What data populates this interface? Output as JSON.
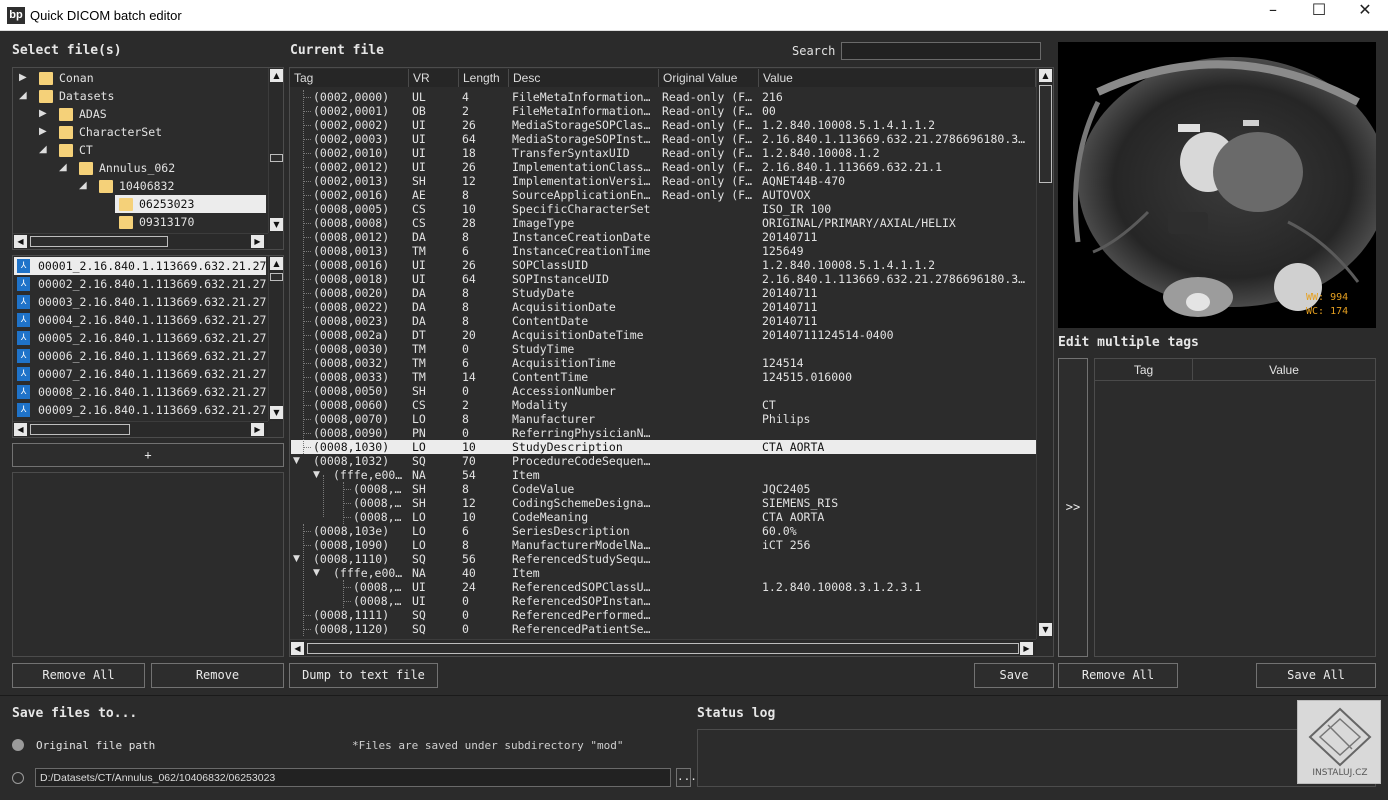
{
  "window": {
    "title": "Quick DICOM batch editor",
    "icon_text": "bp"
  },
  "left": {
    "heading": "Select file(s)",
    "tree": [
      {
        "label": "Conan",
        "level": 0,
        "toggle": "▶"
      },
      {
        "label": "Datasets",
        "level": 0,
        "toggle": "◢"
      },
      {
        "label": "ADAS",
        "level": 1,
        "toggle": "▶"
      },
      {
        "label": "CharacterSet",
        "level": 1,
        "toggle": "▶"
      },
      {
        "label": "CT",
        "level": 1,
        "toggle": "◢"
      },
      {
        "label": "Annulus_062",
        "level": 2,
        "toggle": "◢"
      },
      {
        "label": "10406832",
        "level": 3,
        "toggle": "◢"
      },
      {
        "label": "06253023",
        "level": 4,
        "toggle": "",
        "selected": true
      },
      {
        "label": "09313170",
        "level": 4,
        "toggle": ""
      }
    ],
    "files": [
      {
        "name": "00001_2.16.840.1.113669.632.21.27",
        "selected": true
      },
      {
        "name": "00002_2.16.840.1.113669.632.21.27"
      },
      {
        "name": "00003_2.16.840.1.113669.632.21.27"
      },
      {
        "name": "00004_2.16.840.1.113669.632.21.27"
      },
      {
        "name": "00005_2.16.840.1.113669.632.21.27"
      },
      {
        "name": "00006_2.16.840.1.113669.632.21.27"
      },
      {
        "name": "00007_2.16.840.1.113669.632.21.27"
      },
      {
        "name": "00008_2.16.840.1.113669.632.21.27"
      },
      {
        "name": "00009_2.16.840.1.113669.632.21.27"
      }
    ],
    "add_button": "+",
    "remove_all": "Remove All",
    "remove": "Remove"
  },
  "center": {
    "heading": "Current file",
    "search_label": "Search",
    "search_value": "",
    "columns": [
      "Tag",
      "VR",
      "Length",
      "Desc",
      "Original Value",
      "Value"
    ],
    "rows": [
      {
        "tag": "(0002,0000)",
        "vr": "UL",
        "len": "4",
        "desc": "FileMetaInformation…",
        "orig": "Read-only (F…",
        "val": "216",
        "depth": 0
      },
      {
        "tag": "(0002,0001)",
        "vr": "OB",
        "len": "2",
        "desc": "FileMetaInformation…",
        "orig": "Read-only (F…",
        "val": "00",
        "depth": 0
      },
      {
        "tag": "(0002,0002)",
        "vr": "UI",
        "len": "26",
        "desc": "MediaStorageSOPClas…",
        "orig": "Read-only (F…",
        "val": "1.2.840.10008.5.1.4.1.1.2",
        "depth": 0
      },
      {
        "tag": "(0002,0003)",
        "vr": "UI",
        "len": "64",
        "desc": "MediaStorageSOPInst…",
        "orig": "Read-only (F…",
        "val": "2.16.840.1.113669.632.21.2786696180.3…",
        "depth": 0
      },
      {
        "tag": "(0002,0010)",
        "vr": "UI",
        "len": "18",
        "desc": "TransferSyntaxUID",
        "orig": "Read-only (F…",
        "val": "1.2.840.10008.1.2",
        "depth": 0
      },
      {
        "tag": "(0002,0012)",
        "vr": "UI",
        "len": "26",
        "desc": "ImplementationClass…",
        "orig": "Read-only (F…",
        "val": "2.16.840.1.113669.632.21.1",
        "depth": 0
      },
      {
        "tag": "(0002,0013)",
        "vr": "SH",
        "len": "12",
        "desc": "ImplementationVersi…",
        "orig": "Read-only (F…",
        "val": "AQNET44B-470",
        "depth": 0
      },
      {
        "tag": "(0002,0016)",
        "vr": "AE",
        "len": "8",
        "desc": "SourceApplicationEn…",
        "orig": "Read-only (F…",
        "val": "AUTOVOX",
        "depth": 0
      },
      {
        "tag": "(0008,0005)",
        "vr": "CS",
        "len": "10",
        "desc": "SpecificCharacterSet",
        "orig": "",
        "val": "ISO_IR 100",
        "depth": 0
      },
      {
        "tag": "(0008,0008)",
        "vr": "CS",
        "len": "28",
        "desc": "ImageType",
        "orig": "",
        "val": "ORIGINAL/PRIMARY/AXIAL/HELIX",
        "depth": 0
      },
      {
        "tag": "(0008,0012)",
        "vr": "DA",
        "len": "8",
        "desc": "InstanceCreationDate",
        "orig": "",
        "val": "20140711",
        "depth": 0
      },
      {
        "tag": "(0008,0013)",
        "vr": "TM",
        "len": "6",
        "desc": "InstanceCreationTime",
        "orig": "",
        "val": "125649",
        "depth": 0
      },
      {
        "tag": "(0008,0016)",
        "vr": "UI",
        "len": "26",
        "desc": "SOPClassUID",
        "orig": "",
        "val": "1.2.840.10008.5.1.4.1.1.2",
        "depth": 0
      },
      {
        "tag": "(0008,0018)",
        "vr": "UI",
        "len": "64",
        "desc": "SOPInstanceUID",
        "orig": "",
        "val": "2.16.840.1.113669.632.21.2786696180.3…",
        "depth": 0
      },
      {
        "tag": "(0008,0020)",
        "vr": "DA",
        "len": "8",
        "desc": "StudyDate",
        "orig": "",
        "val": "20140711",
        "depth": 0
      },
      {
        "tag": "(0008,0022)",
        "vr": "DA",
        "len": "8",
        "desc": "AcquisitionDate",
        "orig": "",
        "val": "20140711",
        "depth": 0
      },
      {
        "tag": "(0008,0023)",
        "vr": "DA",
        "len": "8",
        "desc": "ContentDate",
        "orig": "",
        "val": "20140711",
        "depth": 0
      },
      {
        "tag": "(0008,002a)",
        "vr": "DT",
        "len": "20",
        "desc": "AcquisitionDateTime",
        "orig": "",
        "val": "20140711124514-0400",
        "depth": 0
      },
      {
        "tag": "(0008,0030)",
        "vr": "TM",
        "len": "0",
        "desc": "StudyTime",
        "orig": "",
        "val": "",
        "depth": 0
      },
      {
        "tag": "(0008,0032)",
        "vr": "TM",
        "len": "6",
        "desc": "AcquisitionTime",
        "orig": "",
        "val": "124514",
        "depth": 0
      },
      {
        "tag": "(0008,0033)",
        "vr": "TM",
        "len": "14",
        "desc": "ContentTime",
        "orig": "",
        "val": "124515.016000",
        "depth": 0
      },
      {
        "tag": "(0008,0050)",
        "vr": "SH",
        "len": "0",
        "desc": "AccessionNumber",
        "orig": "",
        "val": "",
        "depth": 0
      },
      {
        "tag": "(0008,0060)",
        "vr": "CS",
        "len": "2",
        "desc": "Modality",
        "orig": "",
        "val": "CT",
        "depth": 0
      },
      {
        "tag": "(0008,0070)",
        "vr": "LO",
        "len": "8",
        "desc": "Manufacturer",
        "orig": "",
        "val": "Philips",
        "depth": 0
      },
      {
        "tag": "(0008,0090)",
        "vr": "PN",
        "len": "0",
        "desc": "ReferringPhysicianN…",
        "orig": "",
        "val": "",
        "depth": 0
      },
      {
        "tag": "(0008,1030)",
        "vr": "LO",
        "len": "10",
        "desc": "StudyDescription",
        "orig": "",
        "val": "CTA AORTA",
        "depth": 0,
        "selected": true
      },
      {
        "tag": "(0008,1032)",
        "vr": "SQ",
        "len": "70",
        "desc": "ProcedureCodeSequen…",
        "orig": "",
        "val": "",
        "depth": 0,
        "toggle": "◢"
      },
      {
        "tag": "(fffe,e00…",
        "vr": "NA",
        "len": "54",
        "desc": "Item",
        "orig": "",
        "val": "",
        "depth": 1,
        "toggle": "◢"
      },
      {
        "tag": "(0008,…",
        "vr": "SH",
        "len": "8",
        "desc": "CodeValue",
        "orig": "",
        "val": "JQC2405",
        "depth": 2
      },
      {
        "tag": "(0008,…",
        "vr": "SH",
        "len": "12",
        "desc": "CodingSchemeDesigna…",
        "orig": "",
        "val": "SIEMENS_RIS",
        "depth": 2
      },
      {
        "tag": "(0008,…",
        "vr": "LO",
        "len": "10",
        "desc": "CodeMeaning",
        "orig": "",
        "val": "CTA AORTA",
        "depth": 2
      },
      {
        "tag": "(0008,103e)",
        "vr": "LO",
        "len": "6",
        "desc": "SeriesDescription",
        "orig": "",
        "val": "60.0%",
        "depth": 0
      },
      {
        "tag": "(0008,1090)",
        "vr": "LO",
        "len": "8",
        "desc": "ManufacturerModelNa…",
        "orig": "",
        "val": "iCT 256",
        "depth": 0
      },
      {
        "tag": "(0008,1110)",
        "vr": "SQ",
        "len": "56",
        "desc": "ReferencedStudySequ…",
        "orig": "",
        "val": "",
        "depth": 0,
        "toggle": "◢"
      },
      {
        "tag": "(fffe,e00…",
        "vr": "NA",
        "len": "40",
        "desc": "Item",
        "orig": "",
        "val": "",
        "depth": 1,
        "toggle": "◢"
      },
      {
        "tag": "(0008,…",
        "vr": "UI",
        "len": "24",
        "desc": "ReferencedSOPClassU…",
        "orig": "",
        "val": "1.2.840.10008.3.1.2.3.1",
        "depth": 2
      },
      {
        "tag": "(0008,…",
        "vr": "UI",
        "len": "0",
        "desc": "ReferencedSOPInstan…",
        "orig": "",
        "val": "",
        "depth": 2
      },
      {
        "tag": "(0008,1111)",
        "vr": "SQ",
        "len": "0",
        "desc": "ReferencedPerformed…",
        "orig": "",
        "val": "",
        "depth": 0
      },
      {
        "tag": "(0008,1120)",
        "vr": "SQ",
        "len": "0",
        "desc": "ReferencedPatientSe…",
        "orig": "",
        "val": "",
        "depth": 0
      }
    ],
    "dump_button": "Dump to text file",
    "save_button": "Save"
  },
  "preview": {
    "ww": "WW: 994",
    "wc": "WC: 174"
  },
  "right": {
    "heading": "Edit multiple tags",
    "move_button": ">>",
    "columns": [
      "Tag",
      "Value"
    ],
    "remove_all": "Remove All",
    "save_all": "Save All"
  },
  "bottom": {
    "save_heading": "Save files to...",
    "original_option": "Original file path",
    "note": "*Files are saved under subdirectory \"mod\"",
    "path_value": "D:/Datasets/CT/Annulus_062/10406832/06253023",
    "browse_button": "...",
    "status_heading": "Status log",
    "status_text": "",
    "watermark": "INSTALUJ.CZ"
  },
  "colors": {
    "background": "#2b2b2b",
    "selection": "#ececec",
    "folder": "#f5d179",
    "accent_text": "#e6a020"
  }
}
